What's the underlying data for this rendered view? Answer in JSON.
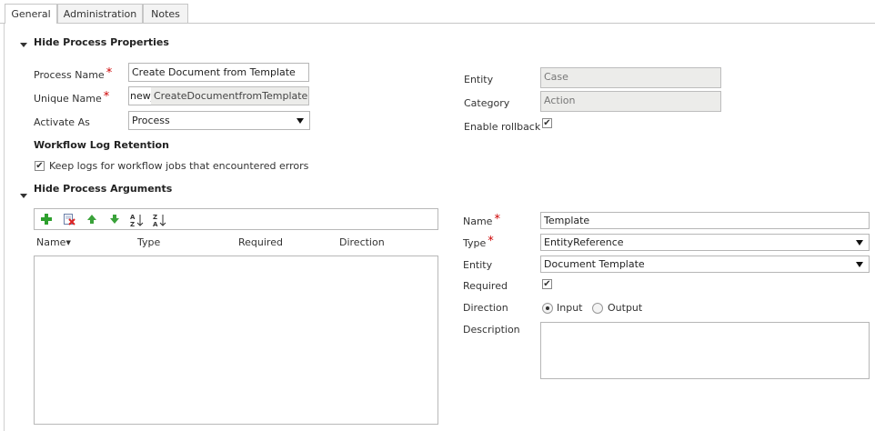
{
  "tabs": [
    {
      "label": "General"
    },
    {
      "label": "Administration"
    },
    {
      "label": "Notes"
    }
  ],
  "process_properties": {
    "section_title": "Hide Process Properties",
    "process_name_label": "Process Name",
    "process_name_value": "Create Document from Template",
    "unique_name_label": "Unique Name",
    "unique_name_prefix": "new_",
    "unique_name_value": "CreateDocumentfromTemplate",
    "activate_as_label": "Activate As",
    "activate_as_value": "Process",
    "entity_label": "Entity",
    "entity_value": "Case",
    "category_label": "Category",
    "category_value": "Action",
    "enable_rollback_label": "Enable rollback",
    "enable_rollback_checked": true,
    "log_retention_title": "Workflow Log Retention",
    "keep_logs_label": "Keep logs for workflow jobs that encountered errors",
    "keep_logs_checked": true
  },
  "process_arguments": {
    "section_title": "Hide Process Arguments",
    "toolbar_icons": [
      "add-icon",
      "delete-icon",
      "move-up-icon",
      "move-down-icon",
      "sort-ascending-icon",
      "sort-descending-icon"
    ],
    "columns": [
      "Name",
      "Type",
      "Required",
      "Direction"
    ],
    "rows": []
  },
  "argument_detail": {
    "name_label": "Name",
    "name_value": "Template",
    "type_label": "Type",
    "type_value": "EntityReference",
    "entity_label": "Entity",
    "entity_value": "Document Template",
    "required_label": "Required",
    "required_checked": true,
    "direction_label": "Direction",
    "direction_options": [
      "Input",
      "Output"
    ],
    "direction_selected": "Input",
    "description_label": "Description",
    "description_value": ""
  },
  "colors": {
    "required_marker": "#cc0000",
    "add_icon": "#2ea02e",
    "arrow_icon": "#3aa23a"
  }
}
